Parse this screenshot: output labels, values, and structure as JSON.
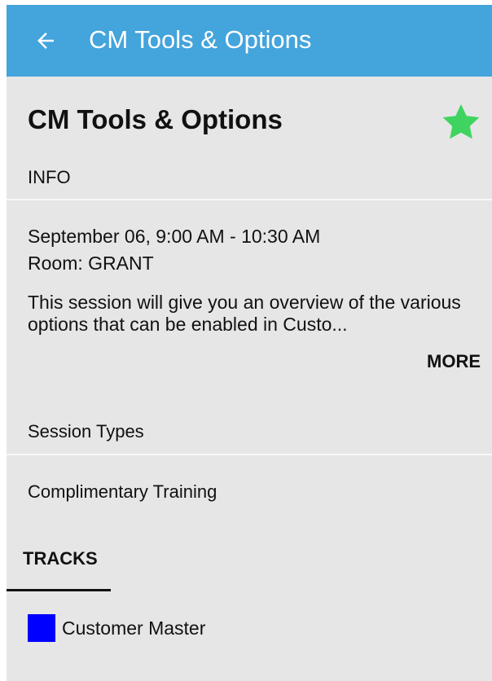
{
  "colors": {
    "appbar": "#44a4dc",
    "background": "#e6e6e6",
    "star": "#3fd45f",
    "track_swatch": "#0000ff"
  },
  "appbar": {
    "back_icon": "arrow-left-icon",
    "title": "CM Tools & Options"
  },
  "session": {
    "title": "CM Tools & Options",
    "favorite_icon": "star-icon",
    "info_header": "INFO",
    "datetime": "September 06, 9:00 AM - 10:30 AM",
    "room": "Room: GRANT",
    "description": "This session will give you an overview of the various options that can be enabled in Custo...",
    "more_label": "MORE",
    "session_types_header": "Session Types",
    "session_type": "Complimentary Training"
  },
  "tabs": [
    {
      "label": "TRACKS",
      "selected": true
    }
  ],
  "tracks": [
    {
      "label": "Customer Master",
      "color": "#0000ff"
    }
  ]
}
